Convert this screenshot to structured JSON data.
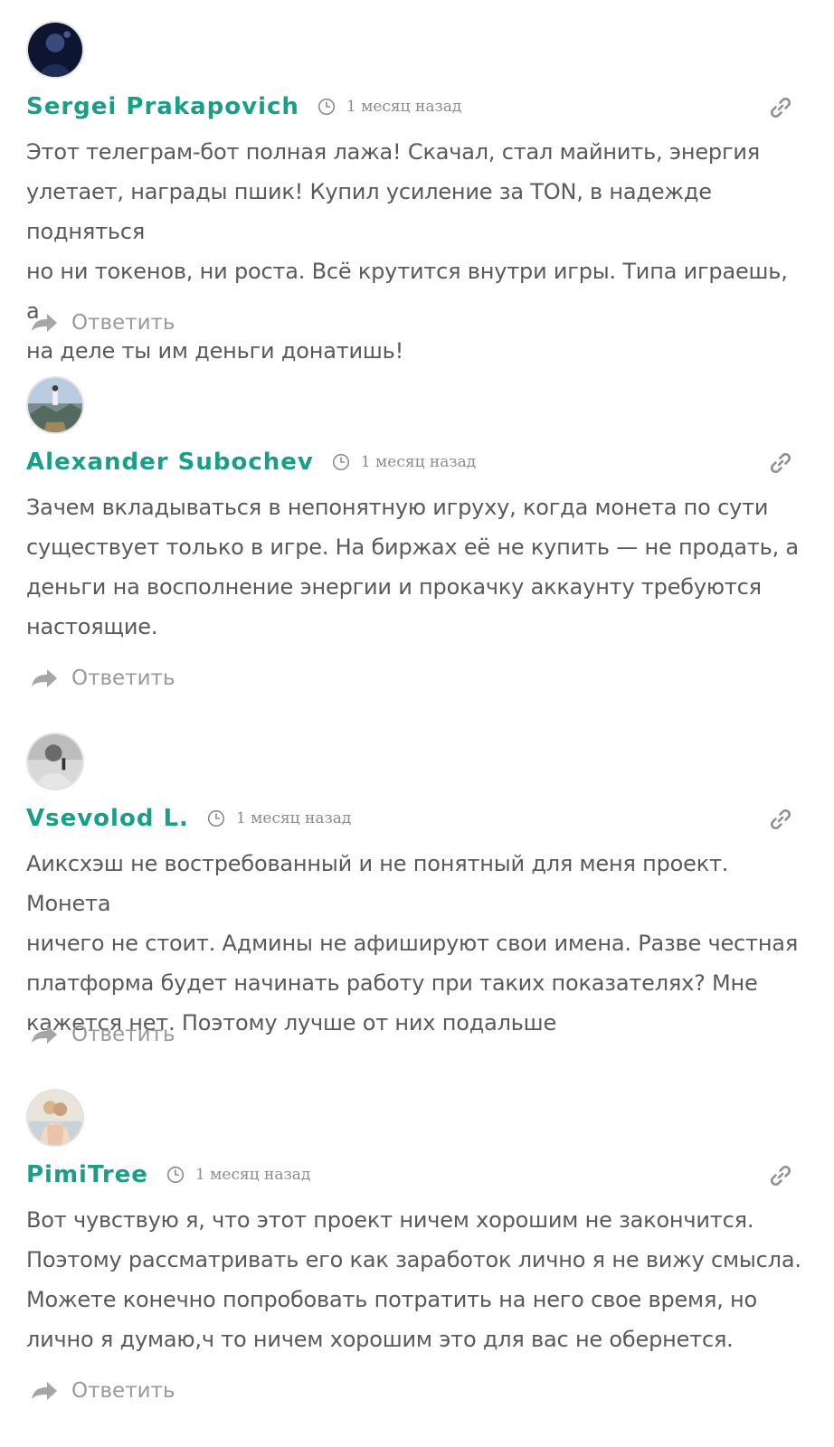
{
  "comments": [
    {
      "author": "Sergei Prakapovich",
      "time": "1 месяц назад",
      "text_lines": [
        "Этот телеграм-бот полная лажа! Скачал, стал майнить, энергия",
        "улетает, награды пшик! Купил усиление за TON, в надежде подняться",
        "но ни токенов, ни роста. Всё крутится внутри игры. Типа играешь, а",
        "на деле ты им деньги донатишь!"
      ],
      "reply_label": "Ответить",
      "avatar_icon": "avatar-photo-dark-portrait"
    },
    {
      "author": "Alexander Subochev",
      "time": "1 месяц назад",
      "text_lines": [
        "Зачем вкладываться в непонятную игруху, когда монета по сути",
        "существует только в игре. На биржах её не купить — не продать, а",
        "деньги на восполнение энергии и прокачку аккаунту требуются",
        "настоящие."
      ],
      "reply_label": "Ответить",
      "avatar_icon": "avatar-photo-mountain"
    },
    {
      "author": "Vsevolod L.",
      "time": "1 месяц назад",
      "text_lines": [
        "Аиксхэш не востребованный и не понятный для меня проект. Монета",
        "ничего не стоит. Админы не афишируют свои имена. Разве честная",
        "платформа будет начинать работу при таких показателях? Мне",
        "кажется нет. Поэтому лучше от них подальше"
      ],
      "reply_label": "Ответить",
      "avatar_icon": "avatar-photo-man-speaking"
    },
    {
      "author": "PimiTree",
      "time": "1 месяц назад",
      "text_lines": [
        "Вот чувствую я, что этот проект ничем хорошим не закончится.",
        "Поэтому рассматривать его как заработок лично я не вижу смысла.",
        "Можете конечно попробовать потратить на него свое время, но",
        "лично я думаю,ч то ничем хорошим это для вас не обернется."
      ],
      "reply_label": "Ответить",
      "avatar_icon": "avatar-photo-couple"
    }
  ],
  "colors": {
    "author": "#1a9e87",
    "meta": "#8c8c8c",
    "body_text": "#5a5a5a",
    "reply": "#9a9a9a"
  },
  "icons": {
    "time": "clock-icon",
    "permalink": "link-icon",
    "reply": "reply-arrow-icon"
  }
}
